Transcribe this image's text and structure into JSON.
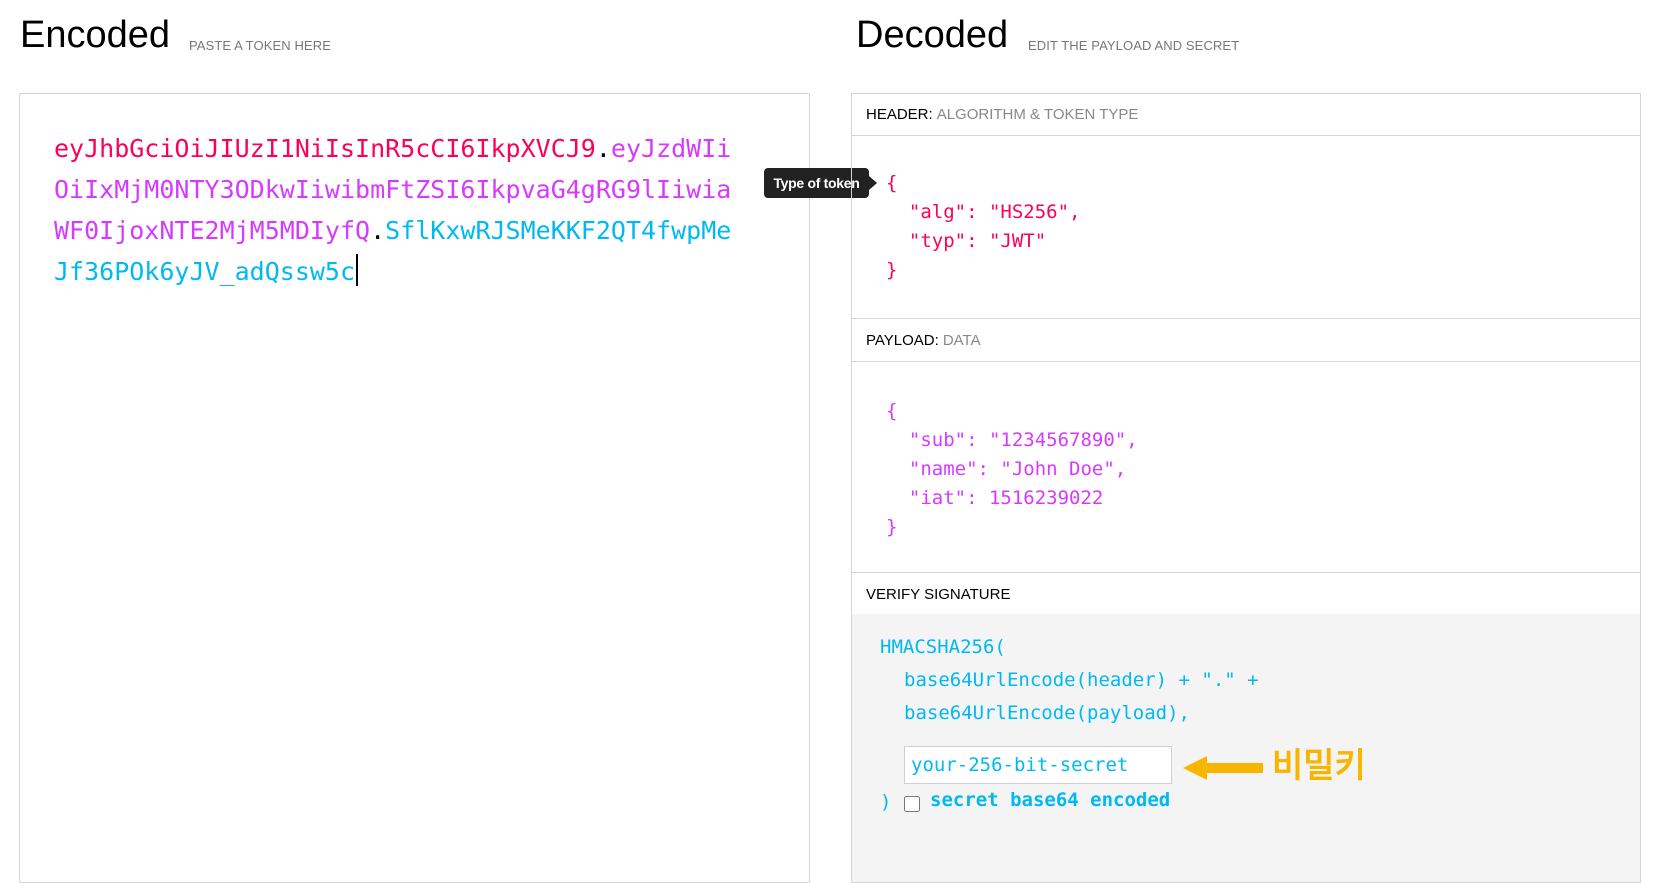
{
  "encoded": {
    "title": "Encoded",
    "subtitle": "PASTE A TOKEN HERE",
    "token_header": "eyJhbGciOiJIUzI1NiIsInR5cCI6IkpXVCJ9",
    "token_payload": "eyJzdWIiOiIxMjM0NTY3ODkwIiwibmFtZSI6IkpvaG4gRG9lIiwiaWF0IjoxNTE2MjM5MDIyfQ",
    "token_signature": "SflKxwRJSMeKKF2QT4fwpMeJf36POk6yJV_adQssw5c",
    "dot": "."
  },
  "tooltip": {
    "text": "Type of token"
  },
  "decoded": {
    "title": "Decoded",
    "subtitle": "EDIT THE PAYLOAD AND SECRET",
    "header": {
      "label": "HEADER:",
      "sublabel": "ALGORITHM & TOKEN TYPE",
      "json": "{\n  \"alg\": \"HS256\",\n  \"typ\": \"JWT\"\n}"
    },
    "payload": {
      "label": "PAYLOAD:",
      "sublabel": "DATA",
      "json": "{\n  \"sub\": \"1234567890\",\n  \"name\": \"John Doe\",\n  \"iat\": 1516239022\n}"
    },
    "verify": {
      "label": "VERIFY SIGNATURE",
      "line1": "HMACSHA256(",
      "line2": "base64UrlEncode(header) + \".\" +",
      "line3": "base64UrlEncode(payload),",
      "secret_placeholder": "your-256-bit-secret",
      "close_paren": ")",
      "checkbox_label": "secret base64 encoded",
      "checkbox_checked": false
    }
  },
  "annotation": {
    "text": "비밀키",
    "color": "#f7b500"
  },
  "colors": {
    "header": "#fb015b",
    "payload": "#d63aff",
    "signature": "#00b9f1"
  }
}
